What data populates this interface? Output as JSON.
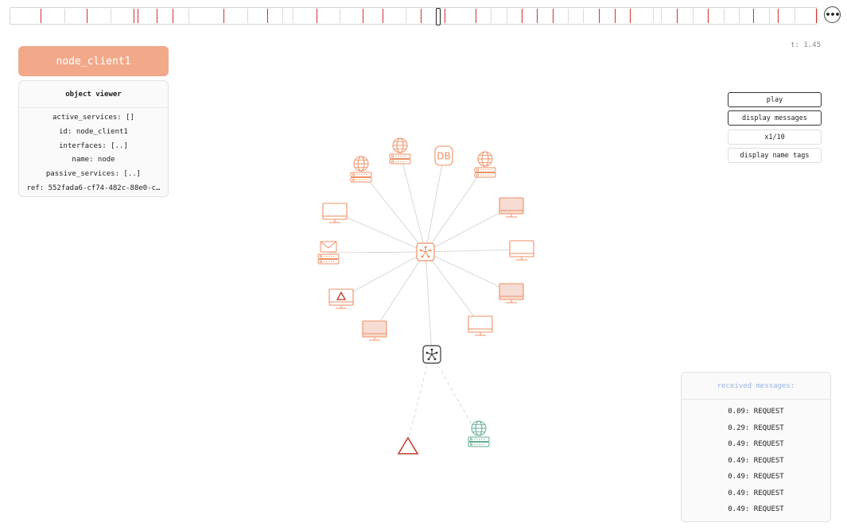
{
  "timeline": {
    "more_label": "•••",
    "tick_color": "#d0312d",
    "minor_tick_color": "#d9d9d9"
  },
  "time_label": "t: 1.45",
  "node_title": {
    "label": "node_client1",
    "color": "#f2a98a"
  },
  "object_viewer": {
    "title": "object viewer",
    "rows": [
      "active_services: []",
      "id: node_client1",
      "interfaces: [..]",
      "name: node",
      "passive_services: [..]",
      "ref: 552fada6-cf74-482c-88e0-c…"
    ]
  },
  "controls": {
    "play": "play",
    "display_messages": "display messages",
    "speed": "x1/10",
    "display_name_tags": "display name tags"
  },
  "received_messages": {
    "title": "received messages:",
    "items": [
      "0.09: REQUEST",
      "0.29: REQUEST",
      "0.49: REQUEST",
      "0.49: REQUEST",
      "0.49: REQUEST",
      "0.49: REQUEST",
      "0.49: REQUEST"
    ]
  },
  "graph": {
    "colors": {
      "orange": "#ef8f63",
      "red": "#c0392b",
      "green": "#5fae8e",
      "black": "#333333",
      "edge": "#cfcfcf"
    },
    "nodes": [
      {
        "id": "hub-orange",
        "icon": "hub-icon",
        "color": "orange"
      },
      {
        "id": "server-web-1",
        "icon": "web-server-icon",
        "color": "orange"
      },
      {
        "id": "server-web-2",
        "icon": "web-server-icon",
        "color": "orange"
      },
      {
        "id": "database",
        "icon": "database-icon",
        "label": "DB",
        "color": "orange"
      },
      {
        "id": "server-web-3",
        "icon": "web-server-icon",
        "color": "orange"
      },
      {
        "id": "monitor-1",
        "icon": "monitor-icon",
        "color": "orange"
      },
      {
        "id": "monitor-2",
        "icon": "monitor-icon",
        "color": "orange",
        "filled": true
      },
      {
        "id": "mail-server",
        "icon": "mail-server-icon",
        "color": "orange"
      },
      {
        "id": "monitor-3",
        "icon": "monitor-icon",
        "color": "orange"
      },
      {
        "id": "monitor-alert",
        "icon": "monitor-alert-icon",
        "color": "orange"
      },
      {
        "id": "monitor-4",
        "icon": "monitor-icon",
        "color": "orange",
        "filled": true
      },
      {
        "id": "monitor-5",
        "icon": "monitor-icon",
        "color": "orange",
        "filled": true
      },
      {
        "id": "monitor-6",
        "icon": "monitor-icon",
        "color": "orange"
      },
      {
        "id": "hub-black",
        "icon": "hub-icon",
        "color": "black"
      },
      {
        "id": "attacker",
        "icon": "warning-triangle-icon",
        "color": "red"
      },
      {
        "id": "server-web-green",
        "icon": "web-server-icon",
        "color": "green"
      }
    ]
  }
}
